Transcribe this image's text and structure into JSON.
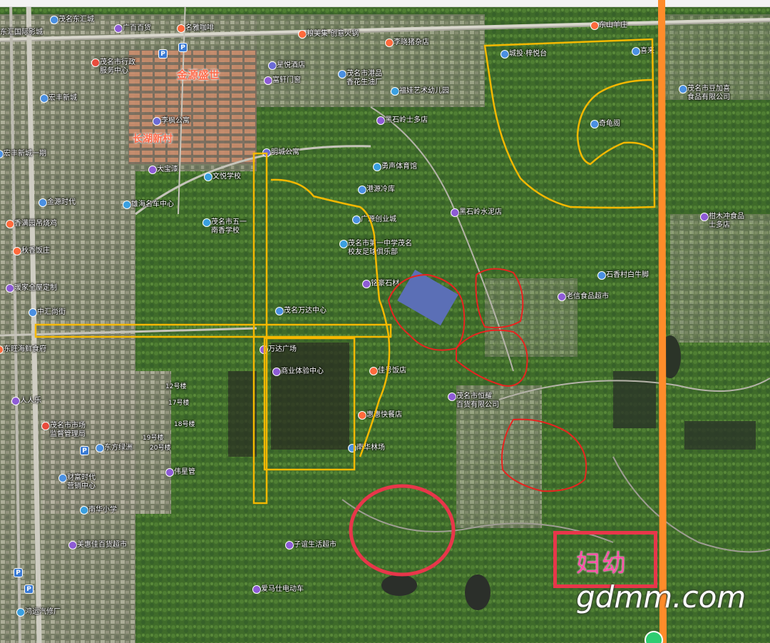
{
  "map": {
    "pois": [
      {
        "label": "茂名东汇城",
        "icon": "pin"
      },
      {
        "label": "东汇国际影城",
        "icon": "pin"
      },
      {
        "label": "广百百货",
        "icon": "shop"
      },
      {
        "label": "名雅咖啡",
        "icon": "food"
      },
      {
        "label": "粮美集·创意火锅",
        "icon": "food"
      },
      {
        "label": "李晓猪杂店",
        "icon": "food"
      },
      {
        "label": "茂名市行政\n服务中心",
        "icon": "gov"
      },
      {
        "label": "星悦酒店",
        "icon": "hotel"
      },
      {
        "label": "茂名市港品\n香花生油厂",
        "icon": "pin"
      },
      {
        "label": "富轩门窗",
        "icon": "shop"
      },
      {
        "label": "福娃艺术幼儿园",
        "icon": "school"
      },
      {
        "label": "宏丰新城",
        "icon": "pin"
      },
      {
        "label": "李枫公寓",
        "icon": "hotel"
      },
      {
        "label": "黑石岭士多店",
        "icon": "shop"
      },
      {
        "label": "明城公寓",
        "icon": "hotel"
      },
      {
        "label": "宏丰新城一期",
        "icon": "pin"
      },
      {
        "label": "勇声体育馆",
        "icon": "sport"
      },
      {
        "label": "大宝漆",
        "icon": "shop"
      },
      {
        "label": "文悦学校",
        "icon": "school"
      },
      {
        "label": "港源冷库",
        "icon": "pin"
      },
      {
        "label": "金源时代",
        "icon": "pin"
      },
      {
        "label": "雄海名车中心",
        "icon": "car"
      },
      {
        "label": "黑石岭水泥店",
        "icon": "shop"
      },
      {
        "label": "广源创业城",
        "icon": "pin"
      },
      {
        "label": "香满园吊烧鸡",
        "icon": "food"
      },
      {
        "label": "茂名市五一\n南香学校",
        "icon": "school"
      },
      {
        "label": "茂名市第一中学茂名\n校友足球俱乐部",
        "icon": "sport"
      },
      {
        "label": "秋香饭庄",
        "icon": "food"
      },
      {
        "label": "铭豪石材",
        "icon": "shop"
      },
      {
        "label": "暖家全屋定制",
        "icon": "shop"
      },
      {
        "label": "中汇尚街",
        "icon": "pin"
      },
      {
        "label": "茂名万达中心",
        "icon": "pin"
      },
      {
        "label": "东旺海鲜食府",
        "icon": "food"
      },
      {
        "label": "万达广场",
        "icon": "shop"
      },
      {
        "label": "商业体验中心",
        "icon": "shop"
      },
      {
        "label": "佳号饭店",
        "icon": "food"
      },
      {
        "label": "人人乐",
        "icon": "shop"
      },
      {
        "label": "茂名市市场\n监督管理局",
        "icon": "gov"
      },
      {
        "label": "惠惠快餐店",
        "icon": "food"
      },
      {
        "label": "东方绿洲",
        "icon": "pin"
      },
      {
        "label": "南华林场",
        "icon": "pin"
      },
      {
        "label": "伟星管",
        "icon": "shop"
      },
      {
        "label": "财富时代\n营销中心",
        "icon": "pin"
      },
      {
        "label": "南华小学",
        "icon": "school"
      },
      {
        "label": "美惠佳百货超市",
        "icon": "shop"
      },
      {
        "label": "子谊生活超市",
        "icon": "shop"
      },
      {
        "label": "爱马仕电动车",
        "icon": "shop"
      },
      {
        "label": "鸿运汽修厂",
        "icon": "car"
      },
      {
        "label": "城投·梓悦台",
        "icon": "pin"
      },
      {
        "label": "东山羊庄",
        "icon": "food"
      },
      {
        "label": "喜来",
        "icon": "pin"
      },
      {
        "label": "茂名市豆加喜\n食品有限公司",
        "icon": "pin"
      },
      {
        "label": "奇龟阁",
        "icon": "pin"
      },
      {
        "label": "柑木冲食品\n士多店",
        "icon": "shop"
      },
      {
        "label": "石香村白牛脚",
        "icon": "pin"
      },
      {
        "label": "老信食品超市",
        "icon": "shop"
      },
      {
        "label": "茂名市恒耀\n百货有限公司",
        "icon": "shop"
      }
    ],
    "districts": [
      "金源盛世",
      "长湖新村"
    ],
    "minor_labels": [
      "12号楼",
      "17号楼",
      "18号楼",
      "19号楼",
      "20号楼"
    ]
  },
  "annotations": {
    "target_label": "妇幼",
    "watermark": "gdmm.com"
  },
  "colors": {
    "yellow_outline": "#f5b800",
    "red_outline": "#e8231f",
    "pink_ellipse": "#e8364a",
    "orange_line": "#ff8c2a",
    "label_pink": "#ff4fa8"
  }
}
